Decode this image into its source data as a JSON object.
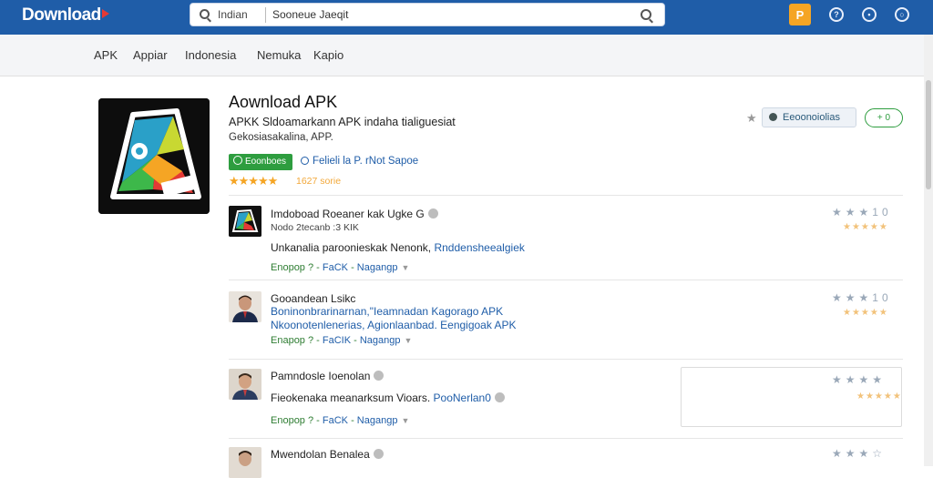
{
  "header": {
    "logo": "Download",
    "search": {
      "scope": "Indian",
      "query": "Sooneue Jaeqit"
    },
    "icon_box_glyph": "P",
    "icons": [
      "box-app-icon",
      "help-icon",
      "user-icon",
      "chat-icon"
    ]
  },
  "nav": {
    "items": [
      "APK",
      "Appiar",
      "Indonesia",
      "Nemuka",
      "Kapio"
    ]
  },
  "app": {
    "title": "Aownload APK",
    "desc1": "APKK Sldoamarkann APK indaha tialiguesiat",
    "desc2": "Gekosiasakalina, APP.",
    "badge": "Eoonboes",
    "meta": "Felieli la  P.  rNot  Sapoe",
    "stars": "★★★★★",
    "rating_text": "1627 sorie",
    "details_button": "Eeoonoiolias",
    "pill_button": "+ 0"
  },
  "list": [
    {
      "title": "Imdoboad Roeaner kak Ugke  G",
      "sub": "Nodo 2tecanb :3 KIK",
      "body_plain": "Unkanalia  paroonieskak Nenonk, ",
      "body_blue": "Rnddensheealgiek",
      "link": "",
      "tags": {
        "a": "Enopop ? -",
        "b": "FaCK",
        "c": "Nagangp"
      },
      "stars_gray": "★★★10",
      "stars_yellow": "★★★★★"
    },
    {
      "title": "Gooandean  Lsikc",
      "sub": "",
      "body_plain": "",
      "body_blue": "",
      "link": "Boninonbrarinarnan,\"Ieamnadan Kagorago APK",
      "link2": "Nkoonotenlenerias, Agionlaanbad.  Eengigoak APK",
      "tags": {
        "a": "Enapop ? -",
        "b": "FaCIK",
        "c": "Nagangp"
      },
      "stars_gray": "★★★10",
      "stars_yellow": "★★★★★"
    },
    {
      "title": "Pamndosle Ioenolan",
      "sub": "",
      "body_plain": "Fieokenaka meanarksum Vioars. ",
      "body_blue": "PooNerlan0",
      "link": "",
      "tags": {
        "a": "Enopop ? -",
        "b": "FaCK",
        "c": "Nagangp"
      },
      "stars_gray": "★★★★",
      "stars_yellow": "★★★★★"
    },
    {
      "title": "Mwendolan Benalea",
      "sub": "",
      "body_plain": "",
      "body_blue": "",
      "link": "",
      "tags": {
        "a": "",
        "b": "",
        "c": ""
      },
      "stars_gray": "★★★☆",
      "stars_yellow": ""
    }
  ],
  "colors": {
    "brand": "#1f5da8",
    "accent": "#f5a524",
    "success": "#2e9d3f"
  }
}
